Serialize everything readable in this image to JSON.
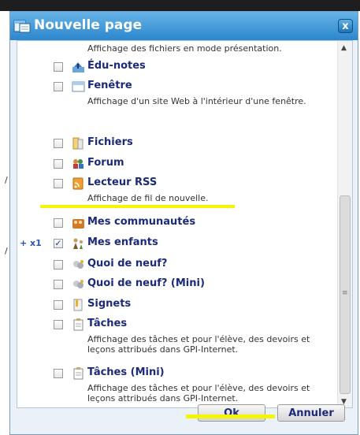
{
  "dialog": {
    "title": "Nouvelle page",
    "close_glyph": "x"
  },
  "list": {
    "top_desc": "Affichage des fichiers en mode présentation.",
    "items": [
      {
        "label": "Édu-notes",
        "checked": false,
        "icon": "edu-notes-icon"
      },
      {
        "label": "Fenêtre",
        "checked": false,
        "icon": "window-icon",
        "desc": "Affichage d'un site Web à l'intérieur d'une fenêtre."
      },
      {
        "label": "Fichiers",
        "checked": false,
        "icon": "folder-icon"
      },
      {
        "label": "Forum",
        "checked": false,
        "icon": "forum-icon"
      },
      {
        "label": "Lecteur RSS",
        "checked": false,
        "icon": "rss-icon",
        "desc": "Affichage de fil de nouvelle."
      },
      {
        "label": "Mes communautés",
        "checked": false,
        "icon": "communities-icon"
      },
      {
        "label": "Mes enfants",
        "checked": true,
        "icon": "children-icon",
        "prefix": "+ x1"
      },
      {
        "label": "Quoi de neuf?",
        "checked": false,
        "icon": "news-icon"
      },
      {
        "label": "Quoi de neuf? (Mini)",
        "checked": false,
        "icon": "news-mini-icon"
      },
      {
        "label": "Signets",
        "checked": false,
        "icon": "bookmark-icon"
      },
      {
        "label": "Tâches",
        "checked": false,
        "icon": "tasks-icon",
        "desc": "Affichage des tâches et pour l'élève, des devoirs et leçons attribués dans GPI-Internet."
      },
      {
        "label": "Tâches (Mini)",
        "checked": false,
        "icon": "tasks-mini-icon",
        "desc": "Affichage des tâches et pour l'élève, des devoirs et leçons attribués dans GPI-Internet."
      }
    ]
  },
  "buttons": {
    "ok": "Ok",
    "cancel": "Annuler"
  },
  "colors": {
    "title_bar": "#2b86cc",
    "label": "#1b2a7a",
    "highlight": "#f5f500"
  }
}
